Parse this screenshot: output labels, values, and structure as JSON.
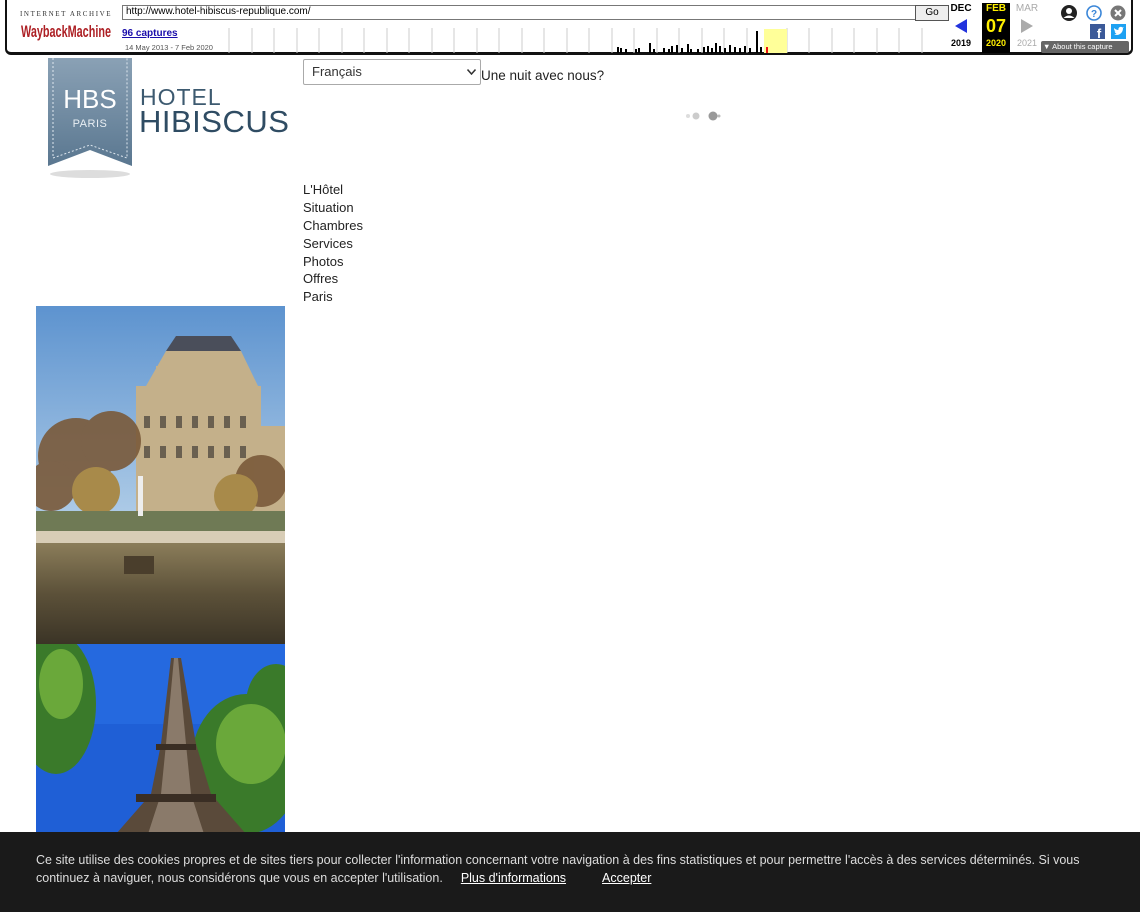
{
  "wayback": {
    "logo_top": "INTERNET ARCHIVE",
    "logo_name": "WaybackMachine",
    "url": "http://www.hotel-hibiscus-republique.com/",
    "go_label": "Go",
    "captures": "96 captures",
    "date_range": "14 May 2013 - 7 Feb 2020",
    "prev_month": "DEC",
    "prev_year": "2019",
    "cur_month": "FEB",
    "cur_day": "07",
    "cur_year": "2020",
    "next_month": "MAR",
    "next_year": "2021",
    "about": "About this capture",
    "icons": [
      "user-icon",
      "help-icon",
      "close-icon",
      "facebook-icon",
      "twitter-icon"
    ],
    "accent_color": "#ffef00"
  },
  "hotel": {
    "ribbon_abbr": "HBS",
    "ribbon_city": "PARIS",
    "name_line1": "HOTEL",
    "name_line2": "HIBISCUS",
    "language_selected": "Français",
    "tagline": "Une nuit avec nous?",
    "nav": [
      "L'Hôtel",
      "Situation",
      "Chambres",
      "Services",
      "Photos",
      "Offres",
      "Paris"
    ],
    "brand_color": "#2f4c63"
  },
  "cookie": {
    "text": "Ce site utilise des cookies propres et de sites tiers pour collecter l'information concernant votre navigation à des fins statistiques et pour permettre l'accès à des services déterminés. Si vous continuez à naviguer, nous considérons que vous en accepter l'utilisation.",
    "more_label": "Plus d'informations",
    "accept_label": "Accepter"
  }
}
